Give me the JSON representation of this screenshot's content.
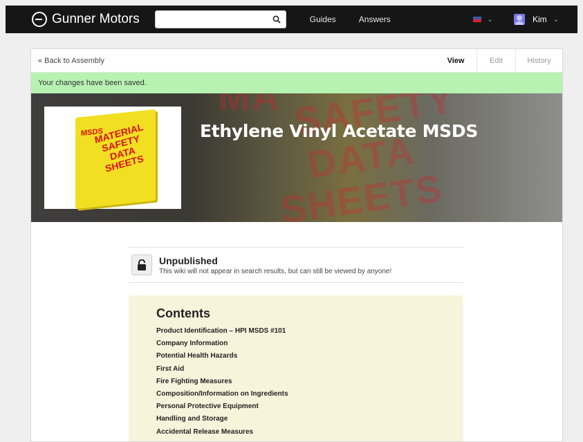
{
  "header": {
    "brand": "Gunner Motors",
    "search_placeholder": "",
    "nav": [
      "Guides",
      "Answers"
    ],
    "user_name": "Kim"
  },
  "page": {
    "back_link": "« Back to Assembly",
    "tabs": [
      {
        "label": "View",
        "active": true
      },
      {
        "label": "Edit",
        "active": false
      },
      {
        "label": "History",
        "active": false
      }
    ],
    "notice": "Your changes have been saved.",
    "title": "Ethylene Vinyl Acetate MSDS",
    "image_text": {
      "spine": "MSDS",
      "cover": "MATERIAL SAFETY DATA SHEETS"
    },
    "status": {
      "title": "Unpublished",
      "description": "This wiki will not appear in search results, but can still be viewed by anyone!"
    },
    "contents": {
      "title": "Contents",
      "items": [
        "Product Identification – HPI MSDS #101",
        "Company Information",
        "Potential Health Hazards",
        "First Aid",
        "Fire Fighting Measures",
        "Composition/Information on Ingredients",
        "Personal Protective Equipment",
        "Handling and Storage",
        "Accidental Release Measures"
      ]
    }
  },
  "colors": {
    "topbar": "#161616",
    "notice_bg": "#b7f2b2",
    "contents_bg": "#f8f4dc",
    "binder_yellow": "#f2df22",
    "binder_red": "#dd1111"
  }
}
